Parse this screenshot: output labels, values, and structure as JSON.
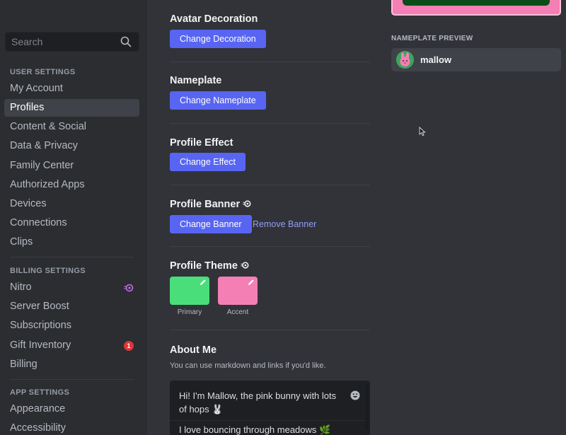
{
  "sidebar": {
    "search": {
      "placeholder": "Search",
      "icon": "search-icon"
    },
    "sections": {
      "user": "User Settings",
      "billing": "Billing Settings",
      "app": "App Settings"
    },
    "user_items": [
      "My Account",
      "Profiles",
      "Content & Social",
      "Data & Privacy",
      "Family Center",
      "Authorized Apps",
      "Devices",
      "Connections",
      "Clips"
    ],
    "selected": "Profiles",
    "billing_items": [
      "Nitro",
      "Server Boost",
      "Subscriptions",
      "Gift Inventory",
      "Billing"
    ],
    "gift_badge": "1",
    "app_items": [
      "Appearance",
      "Accessibility"
    ]
  },
  "main": {
    "avatar_decoration": {
      "title": "Avatar Decoration",
      "button": "Change Decoration"
    },
    "nameplate": {
      "title": "Nameplate",
      "button": "Change Nameplate"
    },
    "profile_effect": {
      "title": "Profile Effect",
      "button": "Change Effect"
    },
    "profile_banner": {
      "title": "Profile Banner",
      "button": "Change Banner",
      "remove": "Remove Banner"
    },
    "profile_theme": {
      "title": "Profile Theme",
      "primary": {
        "label": "Primary",
        "color": "#4ade7a"
      },
      "accent": {
        "label": "Accent",
        "color": "#f47fb4"
      }
    },
    "about_me": {
      "title": "About Me",
      "description": "You can use markdown and links if you'd like.",
      "line1": "Hi! I'm Mallow, the pink bunny with lots of hops 🐰",
      "line2": "I love bouncing through meadows 🌿"
    }
  },
  "preview": {
    "header": "NAMEPLATE PREVIEW",
    "username": "mallow"
  },
  "colors": {
    "accent_button": "#5865f2",
    "sidebar_bg": "#2b2d31",
    "main_bg": "#313338",
    "link": "#949cf7",
    "badge": "#da373c"
  }
}
